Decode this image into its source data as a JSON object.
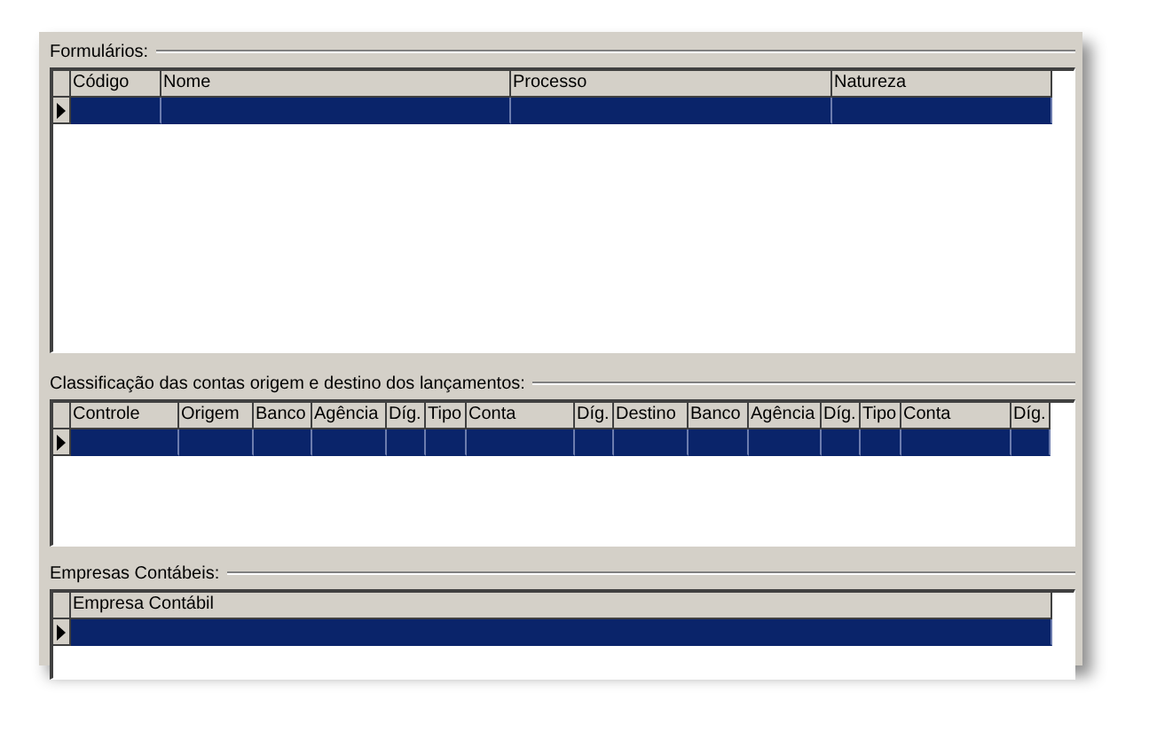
{
  "sections": [
    {
      "title": "Formulários:",
      "columns": [
        "Código",
        "Nome",
        "Processo",
        "Natureza"
      ],
      "rows": [
        {
          "selected": true
        }
      ]
    },
    {
      "title": "Classificação das contas origem e destino dos lançamentos:",
      "columns": [
        "Controle",
        "Origem",
        "Banco",
        "Agência",
        "Díg.",
        "Tipo",
        "Conta",
        "Díg.",
        "Destino",
        "Banco",
        "Agência",
        "Díg.",
        "Tipo",
        "Conta",
        "Díg."
      ],
      "rows": [
        {
          "selected": true
        }
      ]
    },
    {
      "title": "Empresas Contábeis:",
      "columns": [
        "Empresa Contábil"
      ],
      "rows": [
        {
          "selected": true
        }
      ]
    }
  ]
}
